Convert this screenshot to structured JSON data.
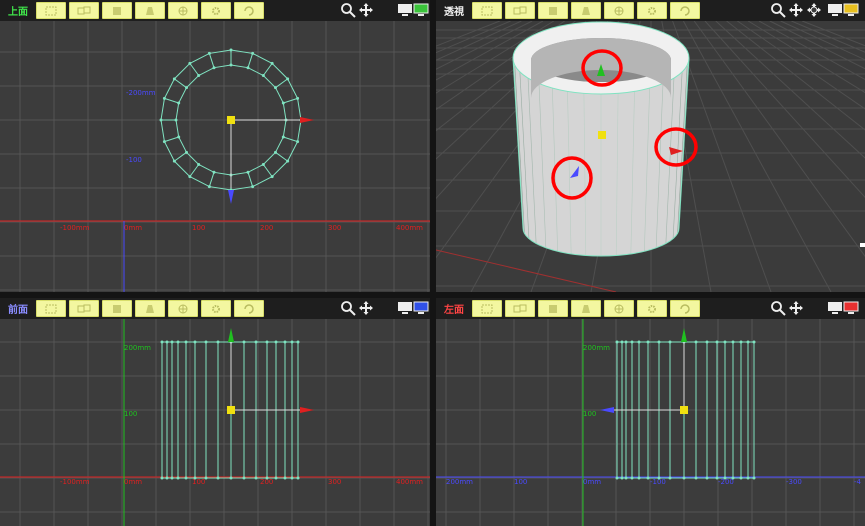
{
  "viewports": {
    "top": {
      "label": "上面",
      "label_color": "#3fe34a",
      "monitor_color": "#3bc43b",
      "x_ticks": [
        "-100mm",
        "0mm",
        "100",
        "200",
        "300",
        "400mm"
      ],
      "y_ticks": [
        "-200mm",
        "-100"
      ]
    },
    "perspective": {
      "label": "透視",
      "label_color": "#f0f0f0",
      "monitor_color": "#e8c020"
    },
    "front": {
      "label": "前面",
      "label_color": "#8a8cff",
      "monitor_color": "#3050e8",
      "x_ticks": [
        "-100mm",
        "0mm",
        "100",
        "200",
        "300",
        "400mm"
      ],
      "y_ticks": [
        "200mm",
        "100"
      ]
    },
    "left": {
      "label": "左面",
      "label_color": "#ff4444",
      "monitor_color": "#e83030",
      "x_ticks": [
        "200mm",
        "100",
        "0mm",
        "-100",
        "-200",
        "-300",
        "-4"
      ],
      "y_ticks": [
        "200mm",
        "100"
      ]
    }
  },
  "toolbar_icons": [
    "select-all-icon",
    "select-group-icon",
    "cube-icon",
    "cylinder-icon",
    "sphere-icon",
    "gear-icon",
    "rotate-icon"
  ],
  "colors": {
    "mesh": "#7fe3c1",
    "x_axis": "#e02020",
    "y_axis": "#20c020",
    "z_axis": "#4a4aff",
    "highlight": "#f0f0a0",
    "annotation": "#ff0000"
  }
}
